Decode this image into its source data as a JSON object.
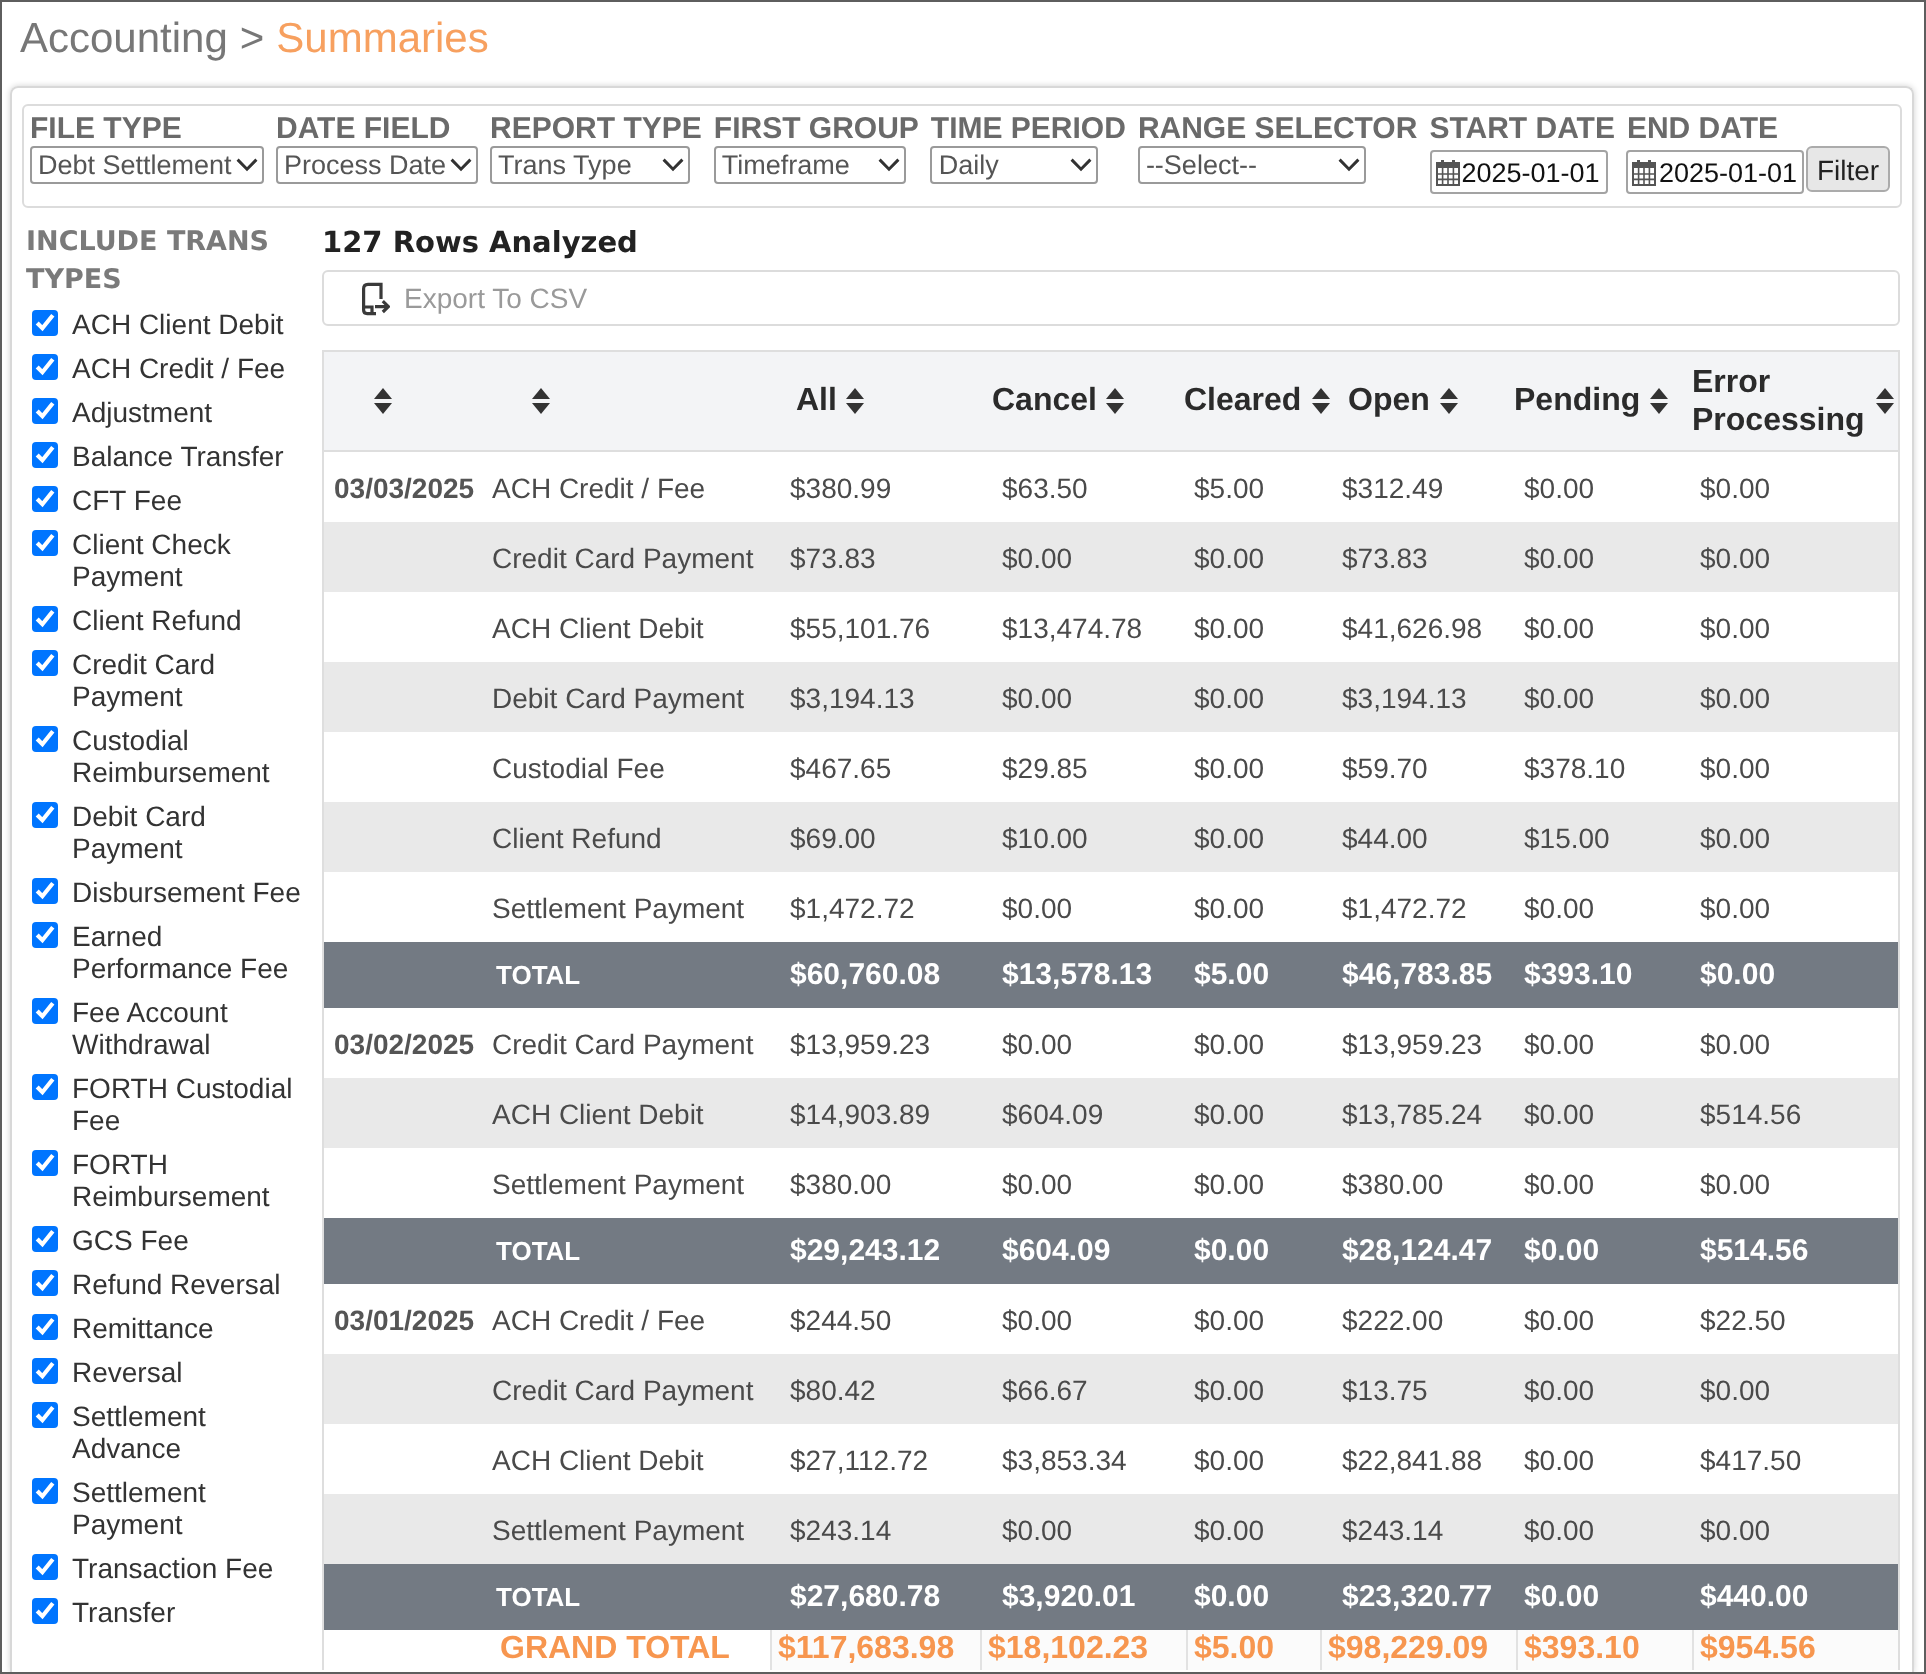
{
  "breadcrumb": {
    "items": [
      {
        "label": "Accounting",
        "current": false
      },
      {
        "label": "Summaries",
        "current": true
      }
    ],
    "separator": ">"
  },
  "filters": [
    {
      "kind": "select",
      "label": "FILE TYPE",
      "value": "Debt Settlement"
    },
    {
      "kind": "select",
      "label": "DATE FIELD",
      "value": "Process Date"
    },
    {
      "kind": "select",
      "label": "REPORT TYPE",
      "value": "Trans Type"
    },
    {
      "kind": "select",
      "label": "FIRST GROUP",
      "value": "Timeframe"
    },
    {
      "kind": "select",
      "label": "TIME PERIOD",
      "value": "Daily"
    },
    {
      "kind": "select",
      "label": "RANGE SELECTOR",
      "value": "--Select--"
    },
    {
      "kind": "date",
      "label": "START DATE",
      "value": "2025-01-01"
    },
    {
      "kind": "date",
      "label": "END DATE",
      "value": "2025-01-01"
    }
  ],
  "filter_button": {
    "label": "Filter"
  },
  "trans_types": {
    "title": "INCLUDE TRANS TYPES",
    "items": [
      {
        "label": "ACH Client Debit",
        "checked": true
      },
      {
        "label": "ACH Credit / Fee",
        "checked": true
      },
      {
        "label": "Adjustment",
        "checked": true
      },
      {
        "label": "Balance Transfer",
        "checked": true
      },
      {
        "label": "CFT Fee",
        "checked": true
      },
      {
        "label": "Client Check Payment",
        "checked": true
      },
      {
        "label": "Client Refund",
        "checked": true
      },
      {
        "label": "Credit Card Payment",
        "checked": true
      },
      {
        "label": "Custodial Reimbursement",
        "checked": true
      },
      {
        "label": "Debit Card Payment",
        "checked": true
      },
      {
        "label": "Disbursement Fee",
        "checked": true
      },
      {
        "label": "Earned Performance Fee",
        "checked": true
      },
      {
        "label": "Fee Account Withdrawal",
        "checked": true
      },
      {
        "label": "FORTH Custodial Fee",
        "checked": true
      },
      {
        "label": "FORTH Reimbursement",
        "checked": true
      },
      {
        "label": "GCS Fee",
        "checked": true
      },
      {
        "label": "Refund Reversal",
        "checked": true
      },
      {
        "label": "Remittance",
        "checked": true
      },
      {
        "label": "Reversal",
        "checked": true
      },
      {
        "label": "Settlement Advance",
        "checked": true
      },
      {
        "label": "Settlement Payment",
        "checked": true
      },
      {
        "label": "Transaction Fee",
        "checked": true
      },
      {
        "label": "Transfer",
        "checked": true
      }
    ]
  },
  "rows_analyzed": "127 Rows Analyzed",
  "export_button": {
    "label": "Export To CSV"
  },
  "table": {
    "columns": [
      {
        "sortable": true
      },
      {
        "sortable": true
      },
      {
        "label": "All",
        "sortable": true
      },
      {
        "label": "Cancel",
        "sortable": true
      },
      {
        "label": "Cleared",
        "sortable": true
      },
      {
        "label": "Open",
        "sortable": true
      },
      {
        "label": "Pending",
        "sortable": true
      },
      {
        "label": "Error Processing",
        "sortable": true
      }
    ],
    "groups": [
      {
        "date": "03/03/2025",
        "rows": [
          {
            "type": "ACH Credit / Fee",
            "values": [
              "$380.99",
              "$63.50",
              "$5.00",
              "$312.49",
              "$0.00",
              "$0.00"
            ]
          },
          {
            "type": "Credit Card Payment",
            "values": [
              "$73.83",
              "$0.00",
              "$0.00",
              "$73.83",
              "$0.00",
              "$0.00"
            ]
          },
          {
            "type": "ACH Client Debit",
            "values": [
              "$55,101.76",
              "$13,474.78",
              "$0.00",
              "$41,626.98",
              "$0.00",
              "$0.00"
            ]
          },
          {
            "type": "Debit Card Payment",
            "values": [
              "$3,194.13",
              "$0.00",
              "$0.00",
              "$3,194.13",
              "$0.00",
              "$0.00"
            ]
          },
          {
            "type": "Custodial Fee",
            "values": [
              "$467.65",
              "$29.85",
              "$0.00",
              "$59.70",
              "$378.10",
              "$0.00"
            ]
          },
          {
            "type": "Client Refund",
            "values": [
              "$69.00",
              "$10.00",
              "$0.00",
              "$44.00",
              "$15.00",
              "$0.00"
            ]
          },
          {
            "type": "Settlement Payment",
            "values": [
              "$1,472.72",
              "$0.00",
              "$0.00",
              "$1,472.72",
              "$0.00",
              "$0.00"
            ]
          }
        ],
        "total": {
          "label": "TOTAL",
          "values": [
            "$60,760.08",
            "$13,578.13",
            "$5.00",
            "$46,783.85",
            "$393.10",
            "$0.00"
          ]
        }
      },
      {
        "date": "03/02/2025",
        "rows": [
          {
            "type": "Credit Card Payment",
            "values": [
              "$13,959.23",
              "$0.00",
              "$0.00",
              "$13,959.23",
              "$0.00",
              "$0.00"
            ]
          },
          {
            "type": "ACH Client Debit",
            "values": [
              "$14,903.89",
              "$604.09",
              "$0.00",
              "$13,785.24",
              "$0.00",
              "$514.56"
            ]
          },
          {
            "type": "Settlement Payment",
            "values": [
              "$380.00",
              "$0.00",
              "$0.00",
              "$380.00",
              "$0.00",
              "$0.00"
            ]
          }
        ],
        "total": {
          "label": "TOTAL",
          "values": [
            "$29,243.12",
            "$604.09",
            "$0.00",
            "$28,124.47",
            "$0.00",
            "$514.56"
          ]
        }
      },
      {
        "date": "03/01/2025",
        "rows": [
          {
            "type": "ACH Credit / Fee",
            "values": [
              "$244.50",
              "$0.00",
              "$0.00",
              "$222.00",
              "$0.00",
              "$22.50"
            ]
          },
          {
            "type": "Credit Card Payment",
            "values": [
              "$80.42",
              "$66.67",
              "$0.00",
              "$13.75",
              "$0.00",
              "$0.00"
            ]
          },
          {
            "type": "ACH Client Debit",
            "values": [
              "$27,112.72",
              "$3,853.34",
              "$0.00",
              "$22,841.88",
              "$0.00",
              "$417.50"
            ]
          },
          {
            "type": "Settlement Payment",
            "values": [
              "$243.14",
              "$0.00",
              "$0.00",
              "$243.14",
              "$0.00",
              "$0.00"
            ]
          }
        ],
        "total": {
          "label": "TOTAL",
          "values": [
            "$27,680.78",
            "$3,920.01",
            "$0.00",
            "$23,320.77",
            "$0.00",
            "$440.00"
          ]
        }
      }
    ],
    "grand_total": {
      "label": "GRAND TOTAL",
      "values": [
        "$117,683.98",
        "$18,102.23",
        "$5.00",
        "$98,229.09",
        "$393.10",
        "$954.56"
      ]
    }
  }
}
